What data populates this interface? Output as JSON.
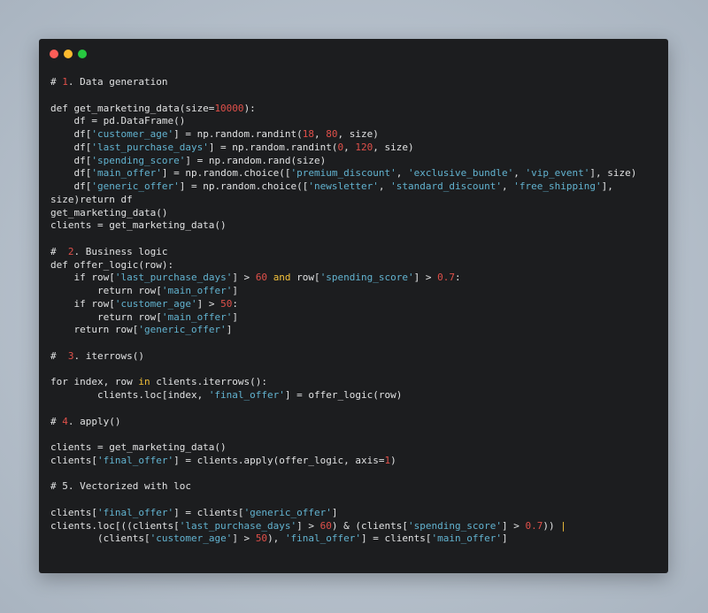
{
  "window": {
    "controls": [
      "close",
      "minimize",
      "maximize"
    ],
    "colors": {
      "close": "#fc5d57",
      "minimize": "#fdbb2e",
      "maximize": "#27c840"
    }
  },
  "syntax_colors": {
    "background": "#1c1d1f",
    "default": "#e1e2e3",
    "string": "#62b3d0",
    "number": "#e0504a",
    "keyword": "#f3c13a"
  },
  "code_lines": [
    [
      [
        "c",
        "# "
      ],
      [
        "n",
        "1"
      ],
      [
        "c",
        ". Data generation"
      ]
    ],
    [],
    [
      [
        "c",
        "def get_marketing_data(size="
      ],
      [
        "n",
        "10000"
      ],
      [
        "c",
        "):"
      ]
    ],
    [
      [
        "c",
        "    df = pd.DataFrame()"
      ]
    ],
    [
      [
        "c",
        "    df["
      ],
      [
        "s",
        "'customer_age'"
      ],
      [
        "c",
        "] = np.random.randint("
      ],
      [
        "n",
        "18"
      ],
      [
        "c",
        ", "
      ],
      [
        "n",
        "80"
      ],
      [
        "c",
        ", size)"
      ]
    ],
    [
      [
        "c",
        "    df["
      ],
      [
        "s",
        "'last_purchase_days'"
      ],
      [
        "c",
        "] = np.random.randint("
      ],
      [
        "n",
        "0"
      ],
      [
        "c",
        ", "
      ],
      [
        "n",
        "120"
      ],
      [
        "c",
        ", size)"
      ]
    ],
    [
      [
        "c",
        "    df["
      ],
      [
        "s",
        "'spending_score'"
      ],
      [
        "c",
        "] = np.random.rand(size)"
      ]
    ],
    [
      [
        "c",
        "    df["
      ],
      [
        "s",
        "'main_offer'"
      ],
      [
        "c",
        "] = np.random.choice(["
      ],
      [
        "s",
        "'premium_discount'"
      ],
      [
        "c",
        ", "
      ],
      [
        "s",
        "'exclusive_bundle'"
      ],
      [
        "c",
        ", "
      ],
      [
        "s",
        "'vip_event'"
      ],
      [
        "c",
        "], size)"
      ]
    ],
    [
      [
        "c",
        "    df["
      ],
      [
        "s",
        "'generic_offer'"
      ],
      [
        "c",
        "] = np.random.choice(["
      ],
      [
        "s",
        "'newsletter'"
      ],
      [
        "c",
        ", "
      ],
      [
        "s",
        "'standard_discount'"
      ],
      [
        "c",
        ", "
      ],
      [
        "s",
        "'free_shipping'"
      ],
      [
        "c",
        "],"
      ]
    ],
    [
      [
        "c",
        "size)return df"
      ]
    ],
    [
      [
        "c",
        "get_marketing_data()"
      ]
    ],
    [
      [
        "c",
        "clients = get_marketing_data()"
      ]
    ],
    [],
    [
      [
        "c",
        "#  "
      ],
      [
        "n",
        "2"
      ],
      [
        "c",
        ". Business logic"
      ]
    ],
    [
      [
        "c",
        "def offer_logic(row):"
      ]
    ],
    [
      [
        "c",
        "    if row["
      ],
      [
        "s",
        "'last_purchase_days'"
      ],
      [
        "c",
        "] > "
      ],
      [
        "n",
        "60"
      ],
      [
        "c",
        " "
      ],
      [
        "k",
        "and"
      ],
      [
        "c",
        " row["
      ],
      [
        "s",
        "'spending_score'"
      ],
      [
        "c",
        "] > "
      ],
      [
        "n",
        "0.7"
      ],
      [
        "c",
        ":"
      ]
    ],
    [
      [
        "c",
        "        return row["
      ],
      [
        "s",
        "'main_offer'"
      ],
      [
        "c",
        "]"
      ]
    ],
    [
      [
        "c",
        "    if row["
      ],
      [
        "s",
        "'customer_age'"
      ],
      [
        "c",
        "] > "
      ],
      [
        "n",
        "50"
      ],
      [
        "c",
        ":"
      ]
    ],
    [
      [
        "c",
        "        return row["
      ],
      [
        "s",
        "'main_offer'"
      ],
      [
        "c",
        "]"
      ]
    ],
    [
      [
        "c",
        "    return row["
      ],
      [
        "s",
        "'generic_offer'"
      ],
      [
        "c",
        "]"
      ]
    ],
    [],
    [
      [
        "c",
        "#  "
      ],
      [
        "n",
        "3"
      ],
      [
        "c",
        ". iterrows()"
      ]
    ],
    [],
    [
      [
        "c",
        "for index, row "
      ],
      [
        "k",
        "in"
      ],
      [
        "c",
        " clients.iterrows():"
      ]
    ],
    [
      [
        "c",
        "        clients.loc[index, "
      ],
      [
        "s",
        "'final_offer'"
      ],
      [
        "c",
        "] = offer_logic(row)"
      ]
    ],
    [],
    [
      [
        "c",
        "# "
      ],
      [
        "n",
        "4"
      ],
      [
        "c",
        ". apply()"
      ]
    ],
    [],
    [
      [
        "c",
        "clients = get_marketing_data()"
      ]
    ],
    [
      [
        "c",
        "clients["
      ],
      [
        "s",
        "'final_offer'"
      ],
      [
        "c",
        "] = clients.apply(offer_logic, axis="
      ],
      [
        "n",
        "1"
      ],
      [
        "c",
        ")"
      ]
    ],
    [],
    [
      [
        "c",
        "# 5. Vectorized with loc"
      ]
    ],
    [],
    [
      [
        "c",
        "clients["
      ],
      [
        "s",
        "'final_offer'"
      ],
      [
        "c",
        "] = clients["
      ],
      [
        "s",
        "'generic_offer'"
      ],
      [
        "c",
        "]"
      ]
    ],
    [
      [
        "c",
        "clients.loc[((clients["
      ],
      [
        "s",
        "'last_purchase_days'"
      ],
      [
        "c",
        "] > "
      ],
      [
        "n",
        "60"
      ],
      [
        "c",
        ") & (clients["
      ],
      [
        "s",
        "'spending_score'"
      ],
      [
        "c",
        "] > "
      ],
      [
        "n",
        "0.7"
      ],
      [
        "c",
        ")) "
      ],
      [
        "k",
        "|"
      ]
    ],
    [
      [
        "c",
        "        (clients["
      ],
      [
        "s",
        "'customer_age'"
      ],
      [
        "c",
        "] > "
      ],
      [
        "n",
        "50"
      ],
      [
        "c",
        "), "
      ],
      [
        "s",
        "'final_offer'"
      ],
      [
        "c",
        "] = clients["
      ],
      [
        "s",
        "'main_offer'"
      ],
      [
        "c",
        "]"
      ]
    ]
  ]
}
